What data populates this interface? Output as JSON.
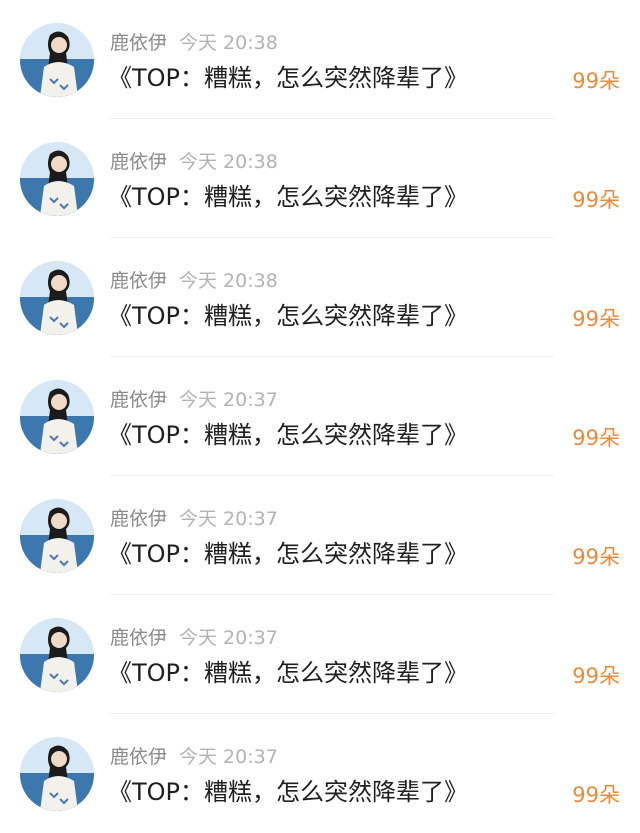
{
  "items": [
    {
      "user": "鹿依伊",
      "time": "今天 20:38",
      "title": "《TOP：糟糕，怎么突然降辈了》",
      "count": "99朵"
    },
    {
      "user": "鹿依伊",
      "time": "今天 20:38",
      "title": "《TOP：糟糕，怎么突然降辈了》",
      "count": "99朵"
    },
    {
      "user": "鹿依伊",
      "time": "今天 20:38",
      "title": "《TOP：糟糕，怎么突然降辈了》",
      "count": "99朵"
    },
    {
      "user": "鹿依伊",
      "time": "今天 20:37",
      "title": "《TOP：糟糕，怎么突然降辈了》",
      "count": "99朵"
    },
    {
      "user": "鹿依伊",
      "time": "今天 20:37",
      "title": "《TOP：糟糕，怎么突然降辈了》",
      "count": "99朵"
    },
    {
      "user": "鹿依伊",
      "time": "今天 20:37",
      "title": "《TOP：糟糕，怎么突然降辈了》",
      "count": "99朵"
    },
    {
      "user": "鹿依伊",
      "time": "今天 20:37",
      "title": "《TOP：糟糕，怎么突然降辈了》",
      "count": "99朵"
    }
  ],
  "colors": {
    "accent": "#ea8a3a",
    "meta": "#9a9a9a",
    "title": "#1f1f1f"
  }
}
